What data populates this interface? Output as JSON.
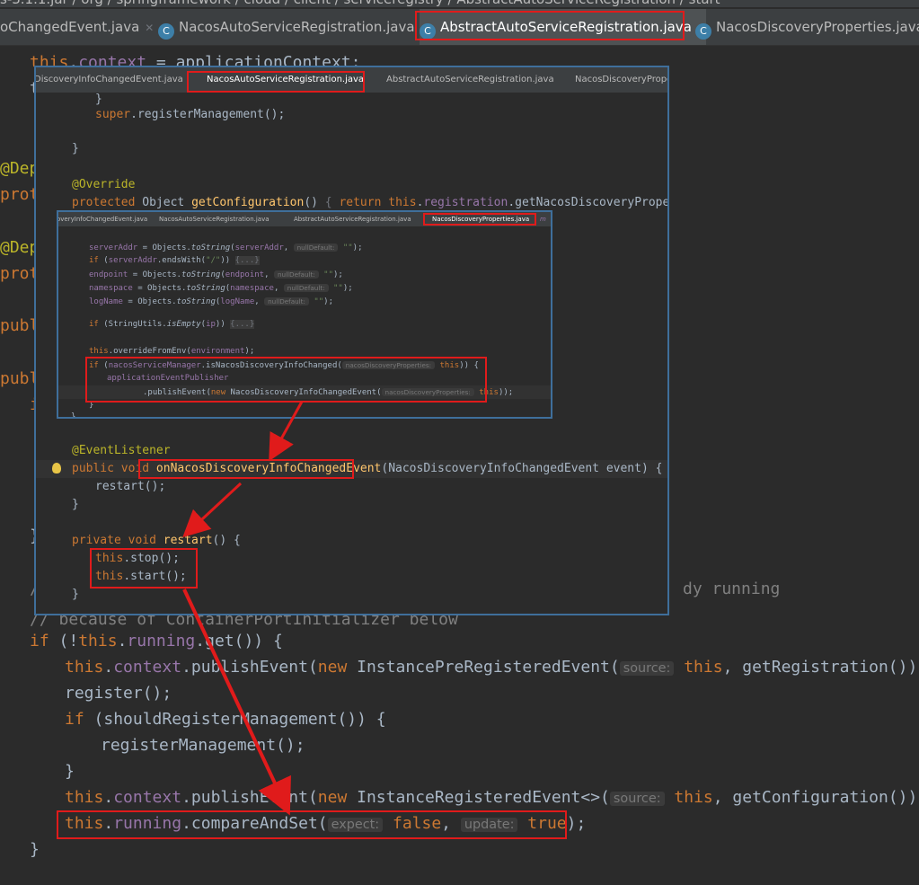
{
  "breadcrumb": "s-3.1.1.jar  /  org  /  springframework  /  cloud  /  client  /  serviceregistry  /  AbstractAutoServiceRegistration  /  start",
  "main_tabs": [
    {
      "label": "oChangedEvent.java",
      "icon": "class-icon"
    },
    {
      "label": "NacosAutoServiceRegistration.java",
      "icon": "class-icon"
    },
    {
      "label": "AbstractAutoServiceRegistration.java",
      "icon": "class-icon"
    },
    {
      "label": "NacosDiscoveryProperties.java",
      "icon": "class-icon"
    }
  ],
  "main_code": {
    "l1a": "this",
    "l1b": ".",
    "l1c": "context",
    "l1d": " = applicationContext;",
    "gut_t": "t",
    "gut_depr1": "@Depr",
    "gut_prote1": "prote",
    "gut_depr2": "@Depr",
    "gut_prote2": "prote",
    "gut_publi1": "publi",
    "gut_publi2": "publi",
    "gut_i": "i",
    "gut_br": "}",
    "gut_slash": "/",
    "dy_running": "dy running",
    "comment_partial": "// because of ContainerPortInitializer below",
    "if_line_a": "if",
    "if_line_b": " (!",
    "if_line_c": "this",
    "if_line_d": ".",
    "if_line_e": "running",
    "if_line_f": ".get()) {",
    "pub1_a": "this",
    "pub1_b": ".",
    "pub1_c": "context",
    "pub1_d": ".publishEvent(",
    "pub1_e": "new",
    "pub1_f": " InstancePreRegisteredEvent(",
    "pub1_hint": "source:",
    "pub1_g": "this",
    "pub1_h": ", getRegistration()));",
    "register": "register();",
    "if2_a": "if",
    "if2_b": " (shouldRegisterManagement()) {",
    "regman": "registerManagement();",
    "close1": "}",
    "pub2_a": "this",
    "pub2_b": ".",
    "pub2_c": "context",
    "pub2_d": ".publishEvent(",
    "pub2_e": "new",
    "pub2_f": " InstanceRegisteredEvent<>(",
    "pub2_hint": "source:",
    "pub2_g": "this",
    "pub2_h": ", getConfiguration()));",
    "cas_a": "this",
    "cas_b": ".",
    "cas_c": "running",
    "cas_d": ".compareAndSet(",
    "cas_hint1": "expect:",
    "cas_e": "false",
    "cas_f": ", ",
    "cas_hint2": "update:",
    "cas_g": "true",
    "cas_h": ");",
    "close2": "}"
  },
  "popup1": {
    "tabs": [
      {
        "label": "DiscoveryInfoChangedEvent.java"
      },
      {
        "label": "NacosAutoServiceRegistration.java"
      },
      {
        "label": "AbstractAutoServiceRegistration.java"
      },
      {
        "label": "NacosDiscoveryPropert"
      }
    ],
    "brace1": "}",
    "super_a": "super",
    "super_b": ".registerManagement();",
    "brace2": "}",
    "override": "@Override",
    "getcfg_a": "protected",
    "getcfg_b": " Object ",
    "getcfg_c": "getConfiguration",
    "getcfg_d": "() ",
    "getcfg_e": "{ ",
    "getcfg_f": "return ",
    "getcfg_g": "this",
    "getcfg_h": ".",
    "getcfg_i": "registration",
    "getcfg_j": ".getNacosDiscoveryProperties(); ",
    "getcfg_k": "}",
    "evt_listener": "@EventListener",
    "onn_a": "public void ",
    "onn_b": "onNacosDiscoveryInfoChangedEvent",
    "onn_c": "(NacosDiscoveryInfoChangedEvent event) {",
    "restart_call": "restart();",
    "brace3": "}",
    "priv_a": "private void ",
    "priv_b": "restart",
    "priv_c": "() {",
    "stop_a": "this",
    "stop_b": ".stop();",
    "start_a": "this",
    "start_b": ".start();",
    "brace4": "}"
  },
  "popup2": {
    "tabs": [
      {
        "label": "overyInfoChangedEvent.java"
      },
      {
        "label": "NacosAutoServiceRegistration.java"
      },
      {
        "label": "AbstractAutoServiceRegistration.java"
      },
      {
        "label": "NacosDiscoveryProperties.java"
      }
    ],
    "tab_more": "m",
    "sa_a": "serverAddr",
    "sa_b": " = Objects.",
    "sa_c": "toString",
    "sa_d": "(",
    "sa_e": "serverAddr",
    "sa_f": ",",
    "sa_hint": "nullDefault:",
    "sa_g": "\"\"",
    "sa_h": ");",
    "if_a": "if",
    "if_b": " (",
    "if_c": "serverAddr",
    "if_d": ".endsWith(",
    "if_e": "\"/\"",
    "if_f": ")) ",
    "if_g": "{...}",
    "ep_a": "endpoint",
    "ep_b": " = Objects.",
    "ep_c": "toString",
    "ep_d": "(",
    "ep_e": "endpoint",
    "ep_f": ",",
    "ep_hint": "nullDefault:",
    "ep_g": "\"\"",
    "ep_h": ");",
    "ns_a": "namespace",
    "ns_b": " = Objects.",
    "ns_c": "toString",
    "ns_d": "(",
    "ns_e": "namespace",
    "ns_f": ",",
    "ns_hint": "nullDefault:",
    "ns_g": "\"\"",
    "ns_h": ");",
    "ln_a": "logName",
    "ln_b": " = Objects.",
    "ln_c": "toString",
    "ln_d": "(",
    "ln_e": "logName",
    "ln_f": ",",
    "ln_hint": "nullDefault:",
    "ln_g": "\"\"",
    "ln_h": ");",
    "ip_a": "if",
    "ip_b": " (StringUtils.",
    "ip_c": "isEmpty",
    "ip_d": "(",
    "ip_e": "ip",
    "ip_f": ")) ",
    "ip_g": "{...}",
    "ofe_a": "this",
    "ofe_b": ".overrideFromEnv(",
    "ofe_c": "environment",
    "ofe_d": ");",
    "nsm_a": "if",
    "nsm_b": " (",
    "nsm_c": "nacosServiceManager",
    "nsm_d": ".isNacosDiscoveryInfoChanged(",
    "nsm_hint": "nacosDiscoveryProperties:",
    "nsm_e": "this",
    "nsm_f": ")) {",
    "aep": "applicationEventPublisher",
    "pe_a": ".publishEvent(",
    "pe_b": "new",
    "pe_c": " NacosDiscoveryInfoChangedEvent(",
    "pe_hint": "nacosDiscoveryProperties:",
    "pe_d": "this",
    "pe_e": "));",
    "brace_a": "}",
    "brace_b": "}"
  }
}
